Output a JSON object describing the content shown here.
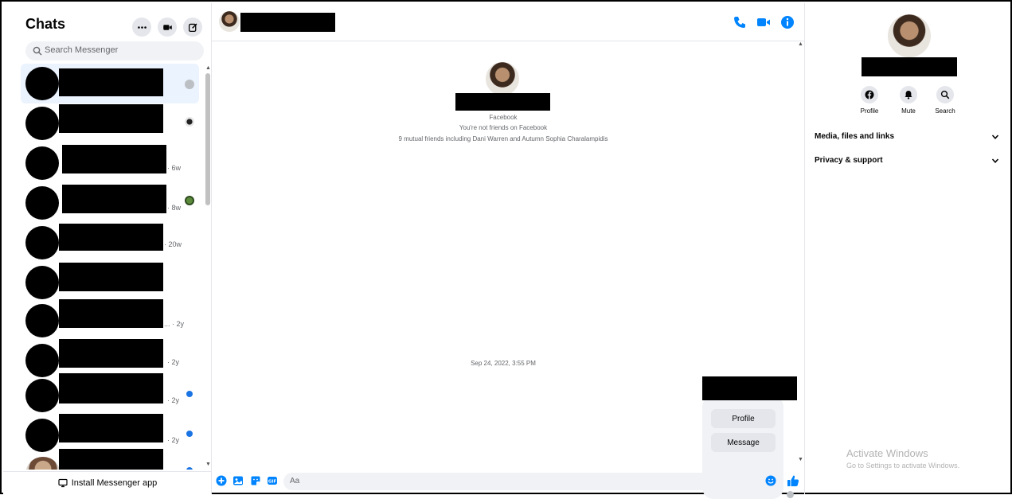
{
  "sidebar": {
    "title": "Chats",
    "search_placeholder": "Search Messenger",
    "install_label": "Install Messenger app",
    "options_icon": "more-icon",
    "video_icon": "video-camera-icon",
    "compose_icon": "compose-icon",
    "chats": [
      {
        "time": "",
        "status": "seen-check"
      },
      {
        "time": "",
        "status": "seen-avatar"
      },
      {
        "time": "· 6w",
        "status": ""
      },
      {
        "time": "· 8w",
        "status": "seen-avatar"
      },
      {
        "time": "· 20w",
        "status": ""
      },
      {
        "time": "",
        "status": ""
      },
      {
        "time": "... · 2y",
        "status": ""
      },
      {
        "time": "· 2y",
        "status": ""
      },
      {
        "time": "· 2y",
        "status": "unread"
      },
      {
        "time": "· 2y",
        "status": "unread"
      },
      {
        "time": "",
        "status": "unread"
      }
    ]
  },
  "conversation": {
    "intro_source": "Facebook",
    "intro_friend_status": "You're not friends on Facebook",
    "intro_mutual": "9 mutual friends including Dani Warren and Autumn Sophia Charalampidis",
    "timestamp": "Sep 24, 2022, 3:55 PM",
    "card_profile_button": "Profile",
    "card_message_button": "Message",
    "composer_placeholder": "Aa"
  },
  "details": {
    "actions": [
      {
        "label": "Profile",
        "icon": "facebook-icon"
      },
      {
        "label": "Mute",
        "icon": "bell-icon"
      },
      {
        "label": "Search",
        "icon": "search-icon"
      }
    ],
    "sections": [
      "Media, files and links",
      "Privacy & support"
    ]
  },
  "watermark": {
    "title": "Activate Windows",
    "subtitle": "Go to Settings to activate Windows."
  },
  "colors": {
    "accent": "#0084ff",
    "active_chat_bg": "#ebf3ff",
    "unread_dot": "#1b74e4"
  }
}
